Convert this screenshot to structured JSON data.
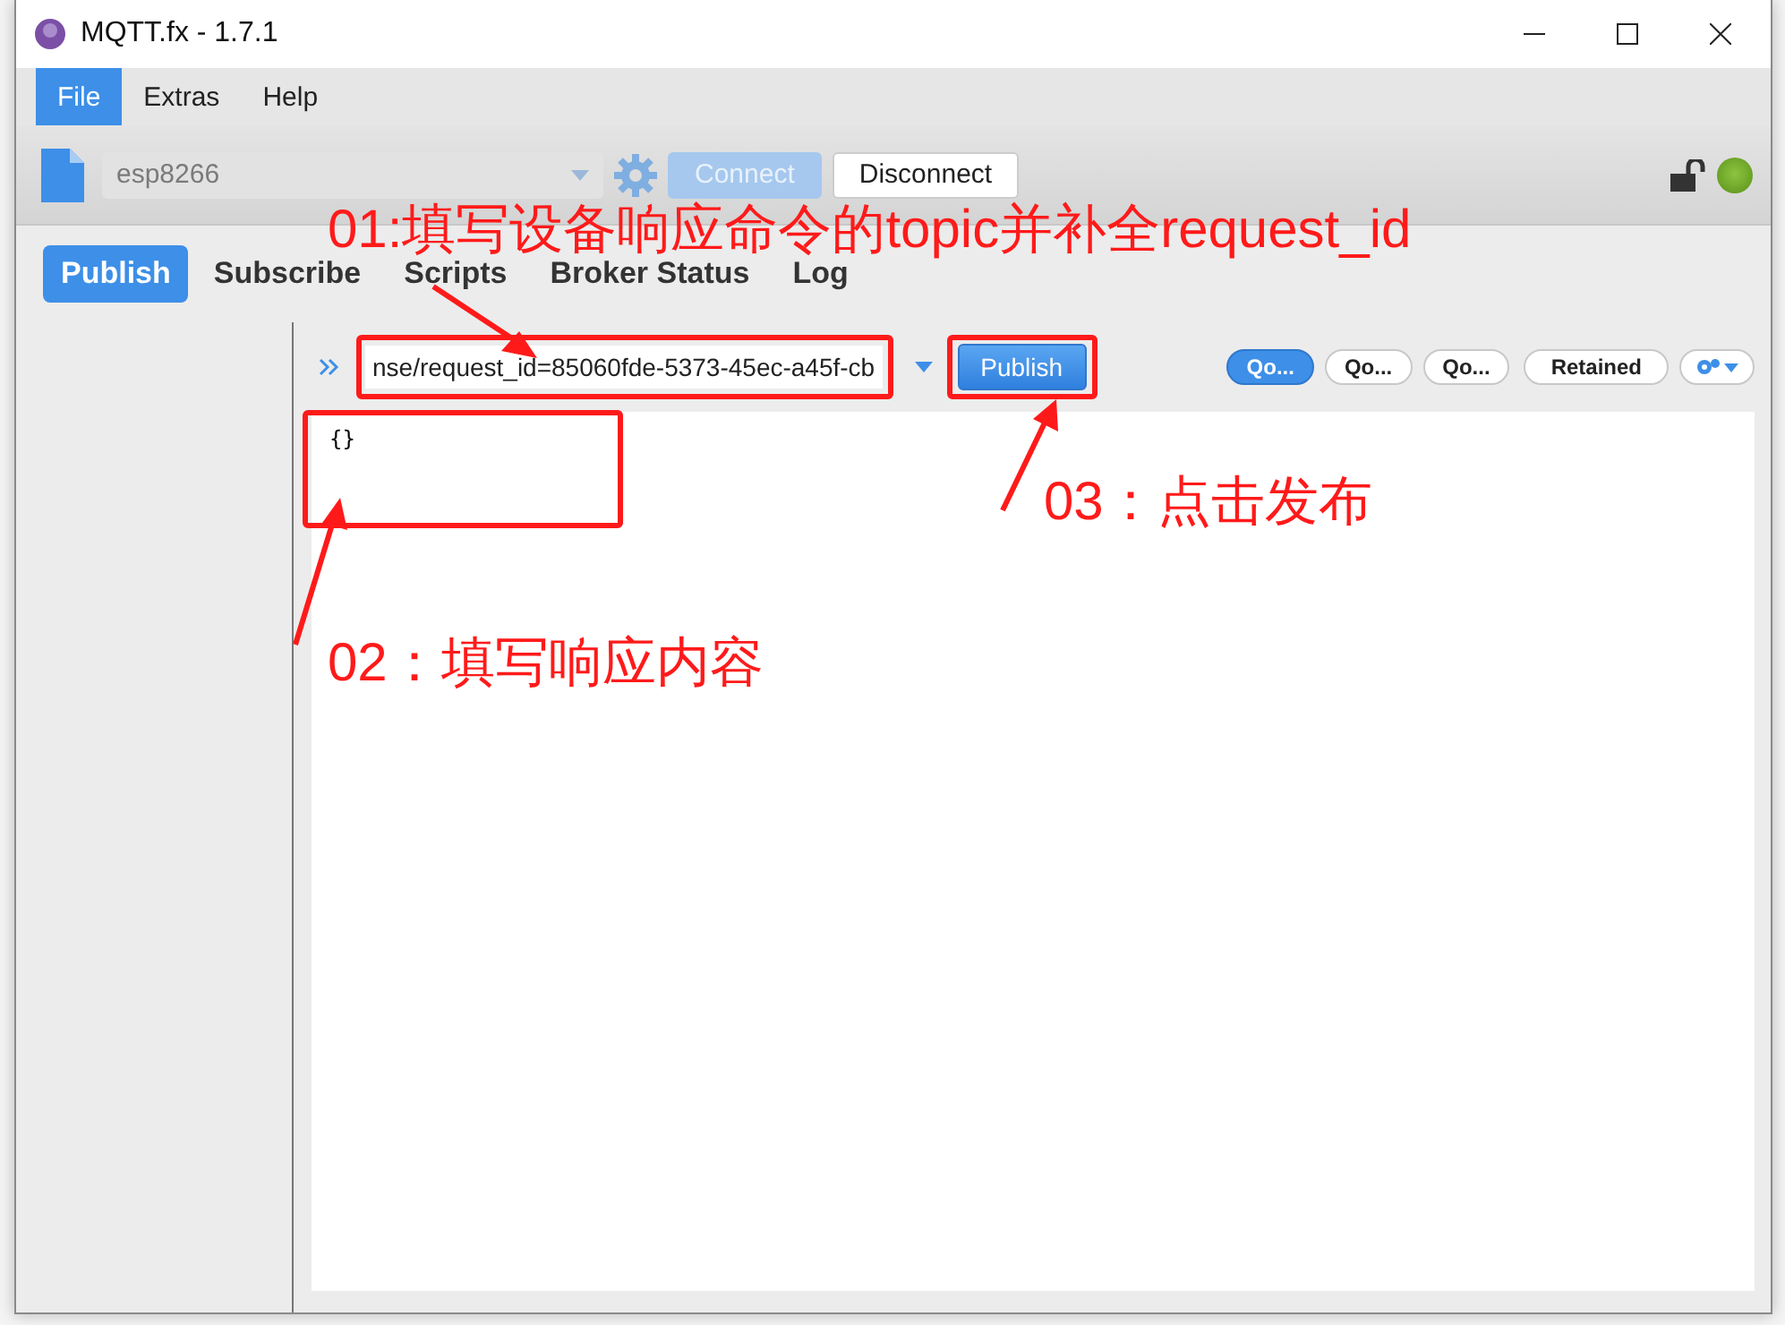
{
  "window": {
    "title": "MQTT.fx - 1.7.1"
  },
  "menu": [
    {
      "label": "File",
      "selected": true
    },
    {
      "label": "Extras",
      "selected": false
    },
    {
      "label": "Help",
      "selected": false
    }
  ],
  "toolbar": {
    "profile": "esp8266",
    "connect": "Connect",
    "disconnect": "Disconnect",
    "connected": true
  },
  "tabs": [
    {
      "label": "Publish",
      "selected": true
    },
    {
      "label": "Subscribe",
      "selected": false
    },
    {
      "label": "Scripts",
      "selected": false
    },
    {
      "label": "Broker Status",
      "selected": false
    },
    {
      "label": "Log",
      "selected": false
    }
  ],
  "publish": {
    "topic": "nse/request_id=85060fde-5373-45ec-a45f-cb",
    "button": "Publish",
    "qos": [
      {
        "label": "Qo...",
        "selected": true
      },
      {
        "label": "Qo...",
        "selected": false
      },
      {
        "label": "Qo...",
        "selected": false
      }
    ],
    "retained": {
      "label": "Retained",
      "selected": false
    },
    "message": "{}"
  },
  "annotations": [
    {
      "text": "01:填写设备响应命令的topic并补全request_id"
    },
    {
      "text": "02：填写响应内容"
    },
    {
      "text": "03：点击发布"
    }
  ]
}
